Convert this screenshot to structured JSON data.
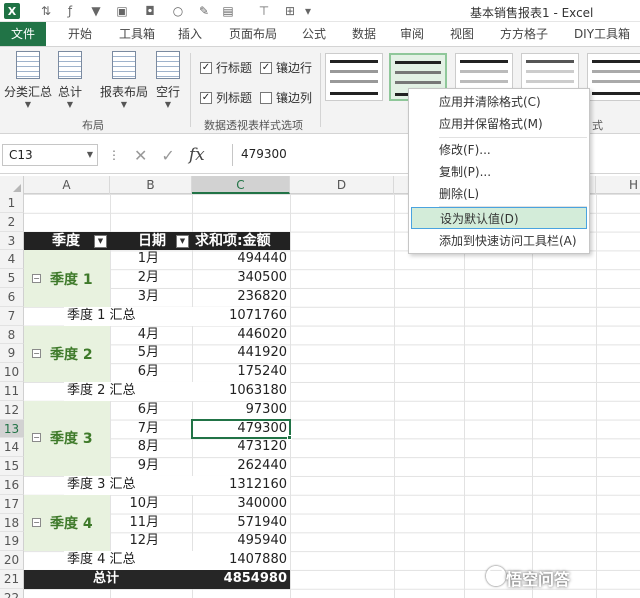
{
  "window": {
    "title": "基本销售报表1 - Excel"
  },
  "ribbon_tabs": [
    "文件",
    "开始",
    "工具箱",
    "插入",
    "页面布局",
    "公式",
    "数据",
    "审阅",
    "视图",
    "方方格子",
    "DIY工具箱"
  ],
  "ribbon": {
    "buttons": {
      "subtotal": "分类汇总",
      "grand_total": "总计",
      "report_layout": "报表布局",
      "blank_rows": "空行"
    },
    "group_layout": "布局",
    "group_style_options": "数据透视表样式选项",
    "group_styles_tail": "式",
    "checkboxes": {
      "row_headers": "行标题",
      "banded_rows": "镶边行",
      "col_headers": "列标题",
      "banded_cols": "镶边列"
    }
  },
  "formula_bar": {
    "name_box": "C13",
    "fx": "fx",
    "value": "479300"
  },
  "columns": [
    "A",
    "B",
    "C",
    "D",
    "E",
    "F",
    "G",
    "H"
  ],
  "rows": [
    "1",
    "2",
    "3",
    "4",
    "5",
    "6",
    "7",
    "8",
    "9",
    "10",
    "11",
    "12",
    "13",
    "14",
    "15",
    "16",
    "17",
    "18",
    "19",
    "20",
    "21",
    "22"
  ],
  "pivot": {
    "headers": {
      "quarter": "季度",
      "date": "日期",
      "sum": "求和项:金额"
    },
    "groups": [
      {
        "label": "季度 1",
        "months": [
          "1月",
          "2月",
          "3月"
        ],
        "values": [
          "494440",
          "340500",
          "236820"
        ],
        "subtotal_label": "季度 1 汇总",
        "subtotal": "1071760"
      },
      {
        "label": "季度 2",
        "months": [
          "4月",
          "5月",
          "6月"
        ],
        "values": [
          "446020",
          "441920",
          "175240"
        ],
        "subtotal_label": "季度 2 汇总",
        "subtotal": "1063180"
      },
      {
        "label": "季度 3",
        "months": [
          "6月",
          "7月",
          "8月",
          "9月"
        ],
        "values": [
          "97300",
          "479300",
          "473120",
          "262440"
        ],
        "subtotal_label": "季度 3 汇总",
        "subtotal": "1312160"
      },
      {
        "label": "季度 4",
        "months": [
          "10月",
          "11月",
          "12月"
        ],
        "values": [
          "340000",
          "571940",
          "495940"
        ],
        "subtotal_label": "季度 4 汇总",
        "subtotal": "1407880"
      }
    ],
    "total_label": "总计",
    "total": "4854980"
  },
  "context_menu": {
    "items": [
      "应用并清除格式(C)",
      "应用并保留格式(M)",
      "修改(F)...",
      "复制(P)...",
      "删除(L)",
      "设为默认值(D)",
      "添加到快速访问工具栏(A)"
    ]
  },
  "watermark": "悟空问答",
  "colors": {
    "excel_green": "#217346",
    "quarter_fill": "#e8f2df",
    "quarter_text": "#3e7a2a",
    "header_dark": "#222222"
  }
}
